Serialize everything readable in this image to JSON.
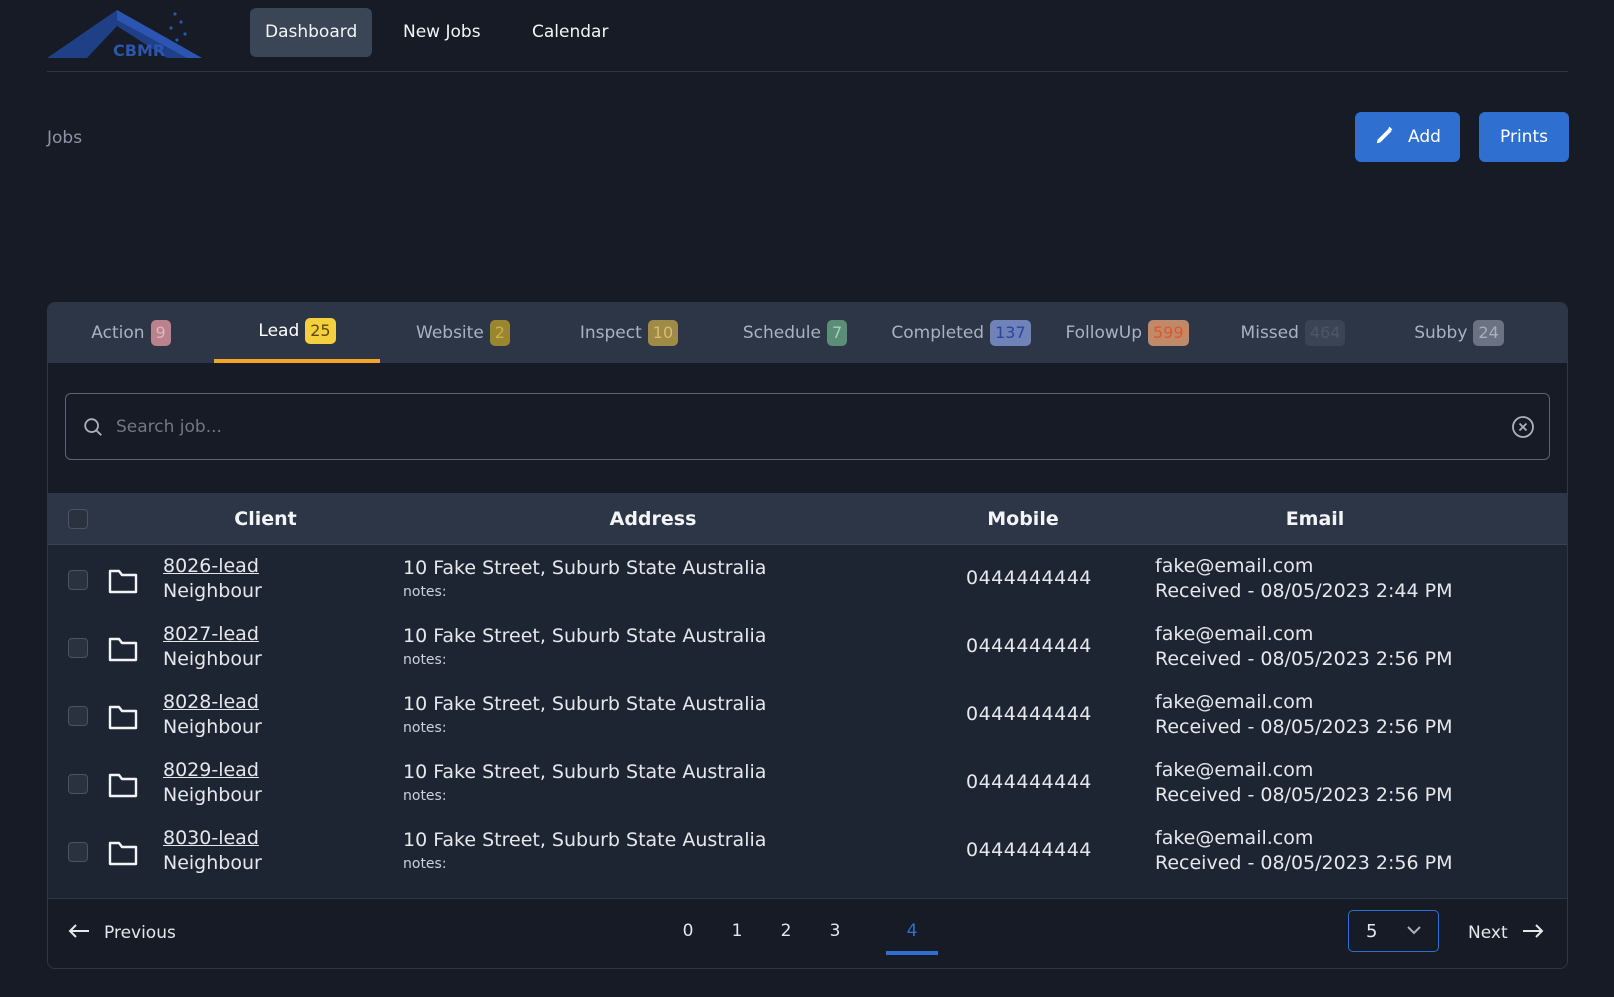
{
  "brand": {
    "logo_text": "CBMR"
  },
  "nav": {
    "items": [
      {
        "label": "Dashboard",
        "active": true
      },
      {
        "label": "New Jobs"
      },
      {
        "label": "Calendar"
      }
    ]
  },
  "page": {
    "title": "Jobs"
  },
  "actions": {
    "add_label": "Add",
    "prints_label": "Prints"
  },
  "tabs": [
    {
      "label": "Action",
      "count": "9",
      "badge_bg": "#b9828c",
      "badge_fg": "#e4b5bc"
    },
    {
      "label": "Lead",
      "count": "25",
      "active": true,
      "badge_bg": "#f4d03f",
      "badge_fg": "#5a4a05"
    },
    {
      "label": "Website",
      "count": "2",
      "badge_bg": "#9b8630",
      "badge_fg": "#cbb04a"
    },
    {
      "label": "Inspect",
      "count": "10",
      "badge_bg": "#a08a48",
      "badge_fg": "#d8be6a"
    },
    {
      "label": "Schedule",
      "count": "7",
      "badge_bg": "#5b8d77",
      "badge_fg": "#9fd3b8"
    },
    {
      "label": "Completed",
      "count": "137",
      "badge_bg": "#6f83b8",
      "badge_fg": "#2945a0"
    },
    {
      "label": "FollowUp",
      "count": "599",
      "badge_bg": "#c08a6a",
      "badge_fg": "#d95a2c"
    },
    {
      "label": "Missed",
      "count": "464",
      "badge_bg": "#3b4454",
      "badge_fg": "#4d5666"
    },
    {
      "label": "Subby",
      "count": "24",
      "badge_bg": "#6b7382",
      "badge_fg": "#a9b0bb"
    }
  ],
  "search": {
    "placeholder": "Search job..."
  },
  "table": {
    "headers": {
      "client": "Client",
      "address": "Address",
      "mobile": "Mobile",
      "email": "Email"
    },
    "rows": [
      {
        "job": "8026-lead",
        "type": "Neighbour",
        "address": "10 Fake Street, Suburb State Australia",
        "notes": "notes:",
        "mobile": "0444444444",
        "email": "fake@email.com",
        "received": "Received - 08/05/2023 2:44 PM"
      },
      {
        "job": "8027-lead",
        "type": "Neighbour",
        "address": "10 Fake Street, Suburb State Australia",
        "notes": "notes:",
        "mobile": "0444444444",
        "email": "fake@email.com",
        "received": "Received - 08/05/2023 2:56 PM"
      },
      {
        "job": "8028-lead",
        "type": "Neighbour",
        "address": "10 Fake Street, Suburb State Australia",
        "notes": "notes:",
        "mobile": "0444444444",
        "email": "fake@email.com",
        "received": "Received - 08/05/2023 2:56 PM"
      },
      {
        "job": "8029-lead",
        "type": "Neighbour",
        "address": "10 Fake Street, Suburb State Australia",
        "notes": "notes:",
        "mobile": "0444444444",
        "email": "fake@email.com",
        "received": "Received - 08/05/2023 2:56 PM"
      },
      {
        "job": "8030-lead",
        "type": "Neighbour",
        "address": "10 Fake Street, Suburb State Australia",
        "notes": "notes:",
        "mobile": "0444444444",
        "email": "fake@email.com",
        "received": "Received - 08/05/2023 2:56 PM"
      }
    ]
  },
  "pagination": {
    "previous_label": "Previous",
    "next_label": "Next",
    "pages": [
      "0",
      "1",
      "2",
      "3",
      "4"
    ],
    "current_page": "4",
    "per_page": "5"
  },
  "colors": {
    "accent": "#2f6fd0",
    "tab_indicator": "#f5a524",
    "background": "#161b25"
  },
  "icons": {
    "add": "pencil-icon",
    "search": "search-icon",
    "clear": "clear-circle-icon",
    "row": "folder-icon",
    "prev": "arrow-left-icon",
    "next": "arrow-right-icon",
    "select": "chevron-down-icon"
  }
}
